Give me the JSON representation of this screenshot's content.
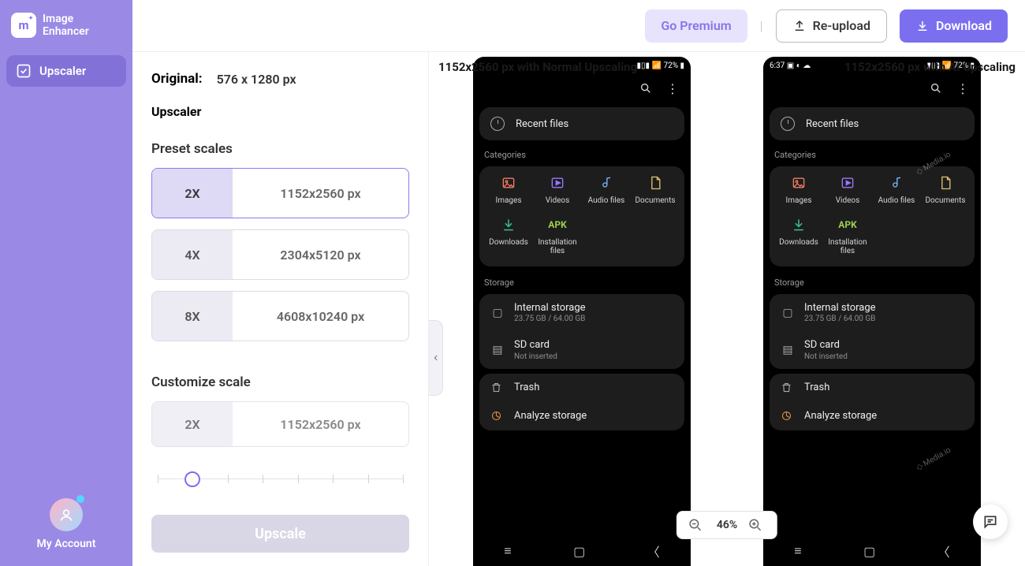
{
  "brand": {
    "line1": "Image",
    "line2": "Enhancer",
    "badge": "m"
  },
  "sidebar": {
    "nav": [
      {
        "label": "Upscaler"
      }
    ],
    "account_label": "My Account"
  },
  "header": {
    "premium": "Go Premium",
    "reupload": "Re-upload",
    "download": "Download"
  },
  "controls": {
    "original_label": "Original:",
    "original_value": "576 x 1280 px",
    "title": "Upscaler",
    "preset_label": "Preset scales",
    "presets": [
      {
        "mult": "2X",
        "dims": "1152x2560 px",
        "selected": true
      },
      {
        "mult": "4X",
        "dims": "2304x5120 px",
        "selected": false
      },
      {
        "mult": "8X",
        "dims": "4608x10240 px",
        "selected": false
      }
    ],
    "custom_label": "Customize scale",
    "custom": {
      "mult": "2X",
      "dims": "1152x2560 px"
    },
    "slider": {
      "ticks": 8,
      "value_index": 1
    },
    "action": "Upscale"
  },
  "preview": {
    "left_label": "1152x2560 px with Normal Upscaling",
    "right_label": "1152x2560 px with AI Upscaling",
    "zoom": "46%",
    "watermark": "Media.io",
    "phone": {
      "status_left_time": "6:37",
      "status_right": "72%",
      "recent": "Recent files",
      "categories_label": "Categories",
      "categories": [
        {
          "key": "images",
          "label": "Images"
        },
        {
          "key": "videos",
          "label": "Videos"
        },
        {
          "key": "audio",
          "label": "Audio files"
        },
        {
          "key": "documents",
          "label": "Documents"
        },
        {
          "key": "downloads",
          "label": "Downloads"
        },
        {
          "key": "apk",
          "label": "Installation files",
          "badge": "APK"
        }
      ],
      "storage_label": "Storage",
      "internal": {
        "title": "Internal storage",
        "sub": "23.75 GB / 64.00 GB"
      },
      "sdcard": {
        "title": "SD card",
        "sub": "Not inserted"
      },
      "trash": "Trash",
      "analyze": "Analyze storage"
    }
  }
}
